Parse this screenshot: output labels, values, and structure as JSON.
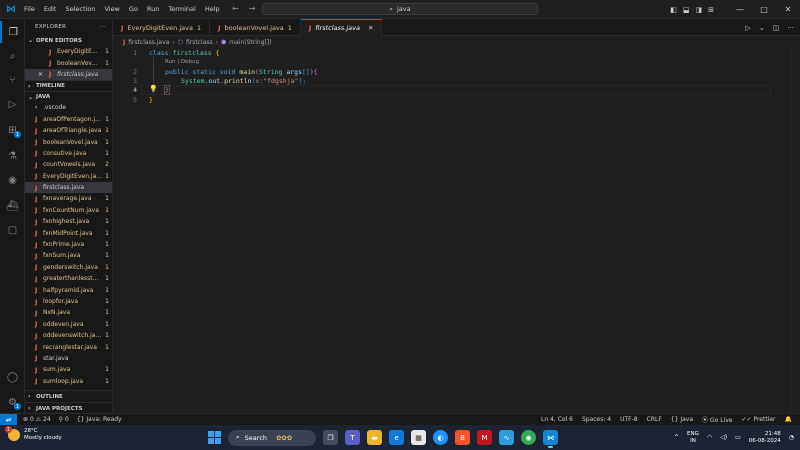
{
  "titlebar": {
    "menu": [
      "File",
      "Edit",
      "Selection",
      "View",
      "Go",
      "Run",
      "Terminal",
      "Help"
    ],
    "search": "java"
  },
  "sidebar": {
    "title": "EXPLORER",
    "open_editors": {
      "label": "OPEN EDITORS",
      "items": [
        {
          "name": "EveryDigitE...",
          "count": "1"
        },
        {
          "name": "booleanVov...",
          "count": "1"
        },
        {
          "name": "firstclass.java",
          "count": ""
        }
      ]
    },
    "timeline": "TIMELINE",
    "java": {
      "label": "JAVA",
      "folder": ".vscode",
      "files": [
        {
          "name": "areaOfPentagon.j...",
          "count": "1"
        },
        {
          "name": "areaOfTriangle.java",
          "count": "1"
        },
        {
          "name": "booleanVovel.java",
          "count": "1"
        },
        {
          "name": "consutive.java",
          "count": "1"
        },
        {
          "name": "countVowels.java",
          "count": "2"
        },
        {
          "name": "EveryDigitEven.ja...",
          "count": "1"
        },
        {
          "name": "firstclass.java",
          "count": ""
        },
        {
          "name": "fxnaverage.java",
          "count": "1"
        },
        {
          "name": "fxnCountNum.java",
          "count": "1"
        },
        {
          "name": "fxnhighest.java",
          "count": "1"
        },
        {
          "name": "fxnMidPoint.java",
          "count": "1"
        },
        {
          "name": "fxnPrime.java",
          "count": "1"
        },
        {
          "name": "fxnSum.java",
          "count": "1"
        },
        {
          "name": "genderswitch.java",
          "count": "1"
        },
        {
          "name": "greaterthanlesst...",
          "count": "1"
        },
        {
          "name": "halfpyramid.java",
          "count": "1"
        },
        {
          "name": "loopfor.java",
          "count": "1"
        },
        {
          "name": "NxN.java",
          "count": "1"
        },
        {
          "name": "oddeven.java",
          "count": "1"
        },
        {
          "name": "oddevenswitch.ja...",
          "count": "1"
        },
        {
          "name": "recranglestar.java",
          "count": "1"
        },
        {
          "name": "star.java",
          "count": ""
        },
        {
          "name": "sum.java",
          "count": "1"
        },
        {
          "name": "sumloop.java",
          "count": "1"
        }
      ]
    },
    "outline": "OUTLINE",
    "java_projects": "JAVA PROJECTS"
  },
  "tabs": [
    {
      "name": "EveryDigitEven.java",
      "count": "1"
    },
    {
      "name": "booleanVovel.java",
      "count": "1"
    },
    {
      "name": "firstclass.java",
      "count": ""
    }
  ],
  "breadcrumb": {
    "file": "firstclass.java",
    "class": "firstclass",
    "method": "main(String[])"
  },
  "editor": {
    "line_numbers": [
      "1",
      "2",
      "3",
      "4",
      "5"
    ],
    "codelens": "Run | Debug",
    "line1_kw": "class",
    "line1_name": "firstclass",
    "line1_brace": "{",
    "line2_mods": "public static void",
    "line2_fn": "main",
    "line2_open": "(",
    "line2_type": "String",
    "line2_var": "args",
    "line2_arr": "[]",
    "line2_close": ")",
    "line2_brace": "{",
    "line3_sys": "System",
    "line3_out": "out",
    "line3_fn": "println",
    "line3_open": "(",
    "line3_hint": "x:",
    "line3_str": "\"fdgshja\"",
    "line3_close": ");",
    "line4": "}",
    "line5": "}"
  },
  "statusbar": {
    "errors": "0",
    "warnings": "24",
    "ports": "0",
    "java_status": "Java: Ready",
    "position": "Ln 4, Col 6",
    "spaces": "Spaces: 4",
    "encoding": "UTF-8",
    "eol": "CRLF",
    "language": "Java",
    "golive": "Go Live",
    "prettier": "Prettier"
  },
  "taskbar": {
    "temp": "28°C",
    "weather": "Mostly cloudy",
    "weather_badge": "1",
    "search": "Search",
    "lang_top": "ENG",
    "lang_bottom": "IN",
    "time": "21:48",
    "date": "06-08-2024"
  },
  "colors": {
    "accent": "#0078d4",
    "java_icon": "#e06c4b",
    "modified_file": "#e2c08d"
  }
}
